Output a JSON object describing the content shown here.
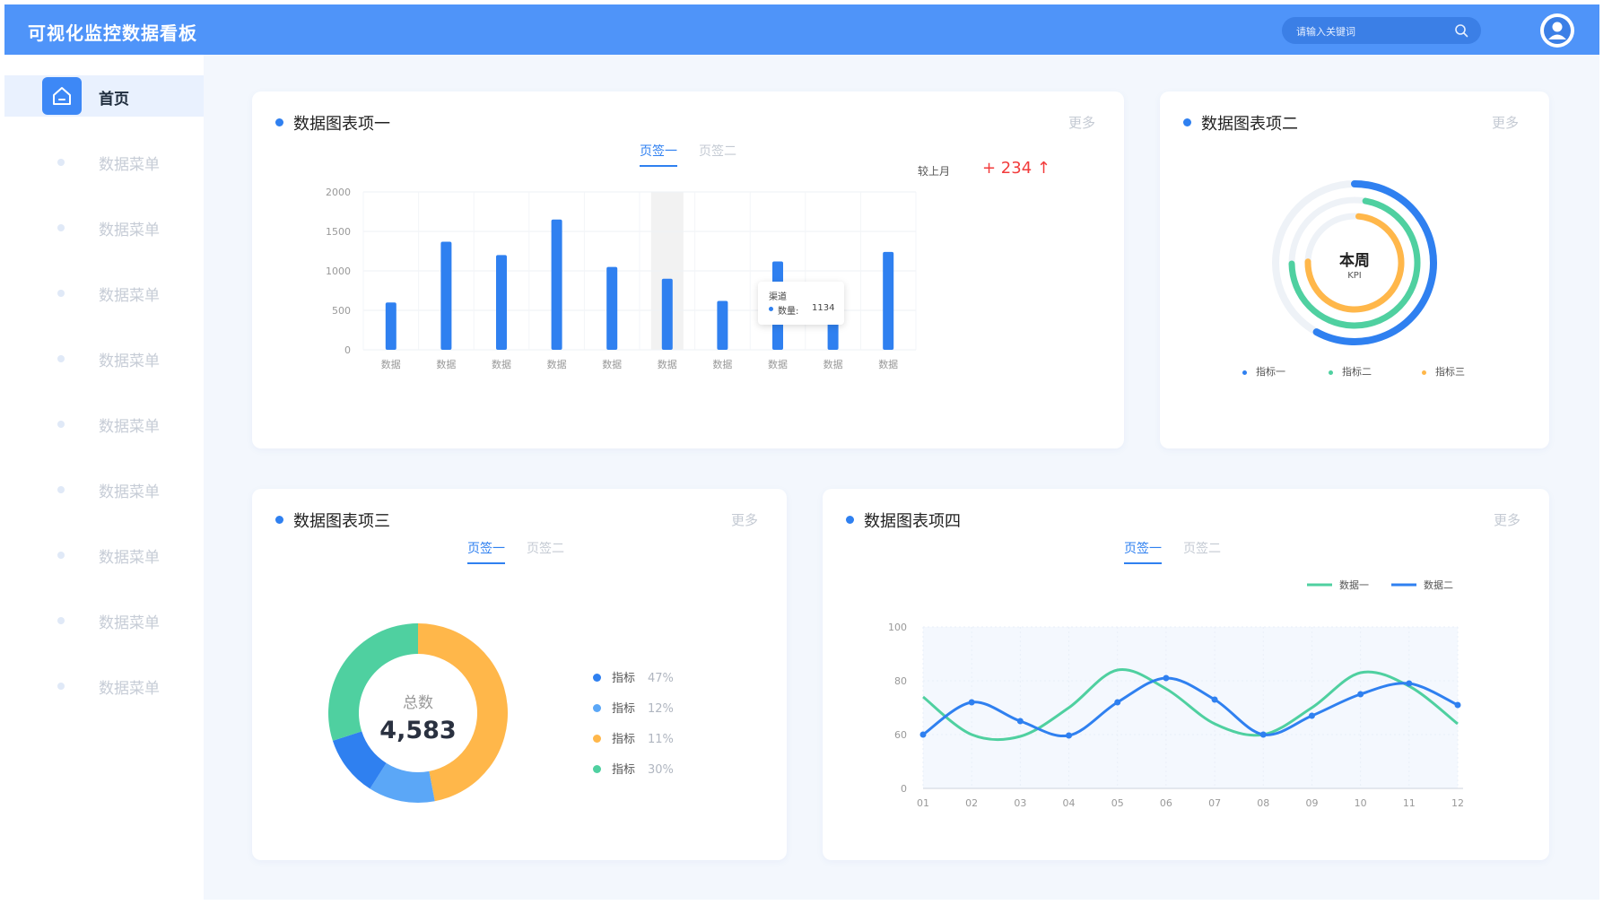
{
  "app": {
    "title": "可视化监控数据看板"
  },
  "search": {
    "placeholder": "请输入关键词"
  },
  "sidebar": {
    "items": [
      {
        "label": "首页",
        "active": true,
        "icon": "home-icon"
      },
      {
        "label": "数据菜单"
      },
      {
        "label": "数据菜单"
      },
      {
        "label": "数据菜单"
      },
      {
        "label": "数据菜单"
      },
      {
        "label": "数据菜单"
      },
      {
        "label": "数据菜单"
      },
      {
        "label": "数据菜单"
      },
      {
        "label": "数据菜单"
      },
      {
        "label": "数据菜单"
      }
    ]
  },
  "colors": {
    "primary": "#2f80f0",
    "green": "#4fd0a0",
    "orange": "#ffb74a",
    "light_blue": "#5ba7f7",
    "red": "#f23b3b",
    "topbar": "#4f94f9"
  },
  "card1": {
    "title": "数据图表项一",
    "more": "更多",
    "tabs": [
      "页签一",
      "页签二"
    ],
    "active_tab": 0,
    "compare_label": "较上月",
    "compare_value": "+ 234 ↑",
    "tooltip": {
      "title": "渠道",
      "label": "数量:",
      "value": "1134"
    }
  },
  "card2": {
    "title": "数据图表项二",
    "more": "更多",
    "center_title": "本周",
    "center_sub": "KPI",
    "legend": [
      {
        "name": "指标一",
        "color": "#2f80f0"
      },
      {
        "name": "指标二",
        "color": "#4fd0a0"
      },
      {
        "name": "指标三",
        "color": "#ffb74a"
      }
    ],
    "ring_values": [
      0.58,
      0.72,
      0.74
    ]
  },
  "card3": {
    "title": "数据图表项三",
    "more": "更多",
    "tabs": [
      "页签一",
      "页签二"
    ],
    "active_tab": 0,
    "center_label": "总数",
    "center_value": "4,583",
    "legend": [
      {
        "name": "指标",
        "pct": "47%",
        "color": "#ffb74a"
      },
      {
        "name": "指标",
        "pct": "12%",
        "color": "#5ba7f7"
      },
      {
        "name": "指标",
        "pct": "11%",
        "color": "#2f80f0"
      },
      {
        "name": "指标",
        "pct": "30%",
        "color": "#4fd0a0"
      }
    ]
  },
  "card4": {
    "title": "数据图表项四",
    "more": "更多",
    "tabs": [
      "页签一",
      "页签二"
    ],
    "active_tab": 0
  },
  "chart_data": [
    {
      "type": "bar",
      "categories": [
        "数据",
        "数据",
        "数据",
        "数据",
        "数据",
        "数据",
        "数据",
        "数据",
        "数据",
        "数据"
      ],
      "values": [
        600,
        1370,
        1200,
        1650,
        1050,
        900,
        620,
        1120,
        420,
        1240
      ],
      "yticks": [
        0,
        500,
        1000,
        1500,
        2000
      ],
      "ylim": [
        0,
        2000
      ],
      "highlight_index": 5,
      "color": "#2f80f0"
    },
    {
      "type": "pie",
      "labels": [
        "指标",
        "指标",
        "指标",
        "指标"
      ],
      "values": [
        47,
        12,
        11,
        30
      ],
      "colors": [
        "#ffb74a",
        "#5ba7f7",
        "#2f80f0",
        "#4fd0a0"
      ]
    },
    {
      "type": "line",
      "x": [
        "01",
        "02",
        "03",
        "04",
        "05",
        "06",
        "07",
        "08",
        "09",
        "10",
        "11",
        "12"
      ],
      "yticks": [
        0,
        60,
        80,
        100
      ],
      "ylim": [
        0,
        100
      ],
      "series": [
        {
          "name": "数据一",
          "color": "#4fd0a0",
          "values": [
            74,
            60,
            58,
            70,
            84,
            77,
            64,
            60,
            70,
            83,
            78,
            64
          ]
        },
        {
          "name": "数据二",
          "color": "#2f80f0",
          "values": [
            60,
            72,
            65,
            59,
            72,
            81,
            73,
            60,
            67,
            75,
            79,
            71
          ]
        }
      ]
    }
  ]
}
